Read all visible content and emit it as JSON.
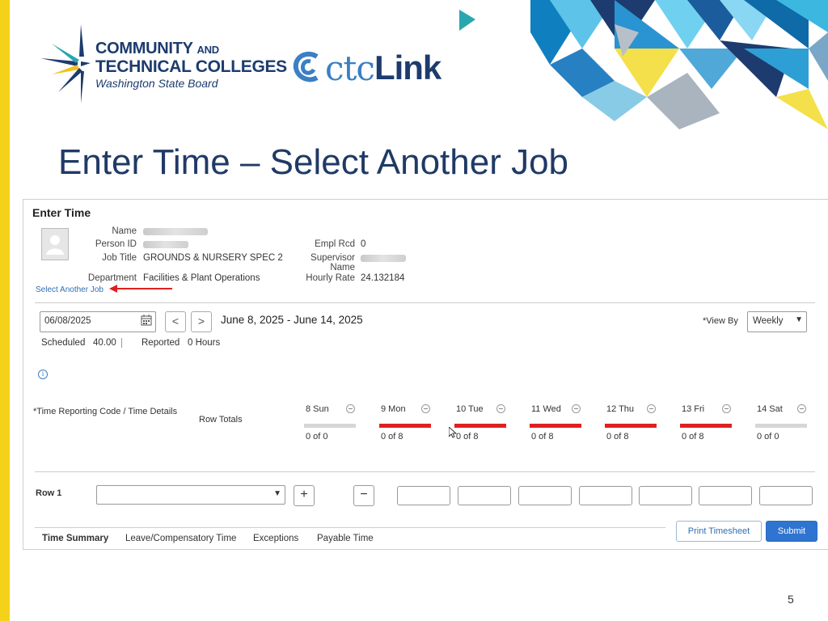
{
  "slide": {
    "title": "Enter Time – Select Another Job",
    "page_number": "5"
  },
  "branding": {
    "org_line1": "COMMUNITY",
    "org_line1_small": "AND",
    "org_line2": "TECHNICAL COLLEGES",
    "org_line3": "Washington State Board",
    "ctc": "ctc",
    "link": "Link",
    "colors": {
      "navy": "#1f3a66",
      "accent_yellow": "#f5d21a",
      "accent_blue": "#3b7fc4"
    }
  },
  "page": {
    "heading": "Enter Time",
    "fields": {
      "name_label": "Name",
      "person_id_label": "Person ID",
      "job_title_label": "Job Title",
      "job_title_value": "GROUNDS & NURSERY SPEC 2",
      "department_label": "Department",
      "department_value": "Facilities & Plant Operations",
      "empl_rcd_label": "Empl Rcd",
      "empl_rcd_value": "0",
      "supervisor_label": "Supervisor",
      "supervisor_label2": "Name",
      "hourly_rate_label": "Hourly Rate",
      "hourly_rate_value": "24.132184"
    },
    "select_another_job": "Select Another Job",
    "date_value": "06/08/2025",
    "prev_label": "<",
    "next_label": ">",
    "date_range": "June 8, 2025 - June 14, 2025",
    "view_by_label": "*View By",
    "view_by_value": "Weekly",
    "scheduled_label": "Scheduled",
    "scheduled_value": "40.00",
    "reported_label": "Reported",
    "reported_value": "0 Hours",
    "info_glyph": "i",
    "trc_label": "*Time Reporting Code / Time Details",
    "row_totals_label": "Row Totals",
    "days": [
      {
        "label": "8 Sun",
        "count": "0 of 0",
        "bar_color": "#d6d6d6"
      },
      {
        "label": "9 Mon",
        "count": "0 of 8",
        "bar_color": "#e02020"
      },
      {
        "label": "10 Tue",
        "count": "0 of 8",
        "bar_color": "#e02020"
      },
      {
        "label": "11 Wed",
        "count": "0 of 8",
        "bar_color": "#e02020"
      },
      {
        "label": "12 Thu",
        "count": "0 of 8",
        "bar_color": "#e02020"
      },
      {
        "label": "13 Fri",
        "count": "0 of 8",
        "bar_color": "#e02020"
      },
      {
        "label": "14 Sat",
        "count": "0 of 0",
        "bar_color": "#d6d6d6"
      }
    ],
    "row1_label": "Row 1",
    "add_label": "+",
    "remove_label": "−",
    "print_timesheet": "Print Timesheet",
    "submit": "Submit",
    "tabs": [
      "Time Summary",
      "Leave/Compensatory Time",
      "Exceptions",
      "Payable Time"
    ]
  }
}
